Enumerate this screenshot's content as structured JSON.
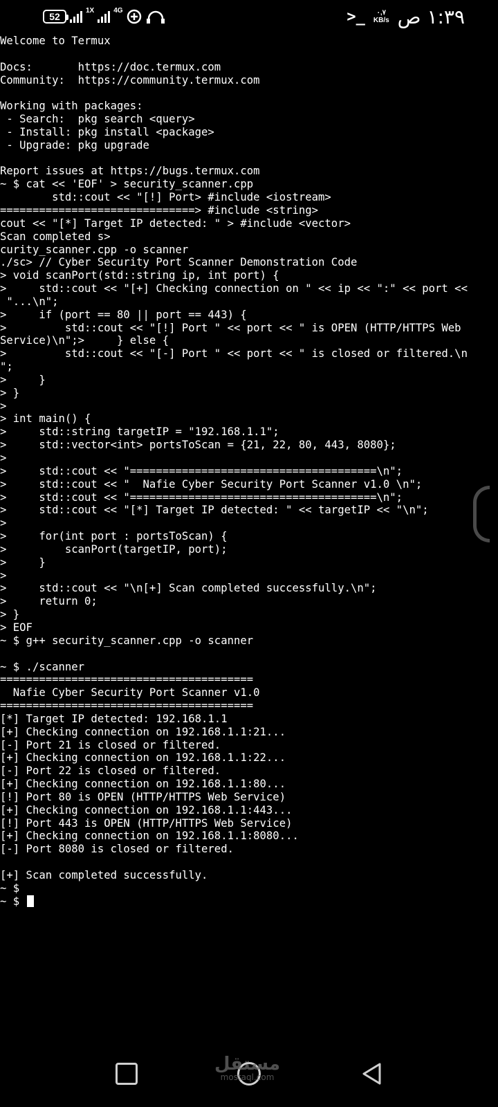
{
  "status_bar": {
    "battery": "52",
    "signal1_label": "1X",
    "signal2_label": "4G",
    "net_speed_value": "٠,٧",
    "net_speed_unit": "KB/s",
    "time": "١:٣٩ ص",
    "icons": [
      "battery-icon",
      "signal-icon",
      "signal-icon",
      "data-saver-icon",
      "headset-icon",
      "terminal-icon"
    ]
  },
  "terminal": {
    "lines": [
      "Welcome to Termux",
      "",
      "Docs:       https://doc.termux.com",
      "Community:  https://community.termux.com",
      "",
      "Working with packages:",
      " - Search:  pkg search <query>",
      " - Install: pkg install <package>",
      " - Upgrade: pkg upgrade",
      "",
      "Report issues at https://bugs.termux.com",
      "~ $ cat << 'EOF' > security_scanner.cpp",
      "        std::cout << \"[!] Port> #include <iostream>",
      "==============================> #include <string>",
      "cout << \"[*] Target IP detected: \" > #include <vector>",
      "Scan completed s>",
      "curity_scanner.cpp -o scanner",
      "./sc> // Cyber Security Port Scanner Demonstration Code",
      "> void scanPort(std::string ip, int port) {",
      ">     std::cout << \"[+] Checking connection on \" << ip << \":\" << port <<",
      " \"...\\n\";",
      ">     if (port == 80 || port == 443) {",
      ">         std::cout << \"[!] Port \" << port << \" is OPEN (HTTP/HTTPS Web",
      "Service)\\n\";>     } else {",
      ">         std::cout << \"[-] Port \" << port << \" is closed or filtered.\\n",
      "\";",
      ">     }",
      "> }",
      ">",
      "> int main() {",
      ">     std::string targetIP = \"192.168.1.1\";",
      ">     std::vector<int> portsToScan = {21, 22, 80, 443, 8080};",
      ">",
      ">     std::cout << \"======================================\\n\";",
      ">     std::cout << \"  Nafie Cyber Security Port Scanner v1.0 \\n\";",
      ">     std::cout << \"======================================\\n\";",
      ">     std::cout << \"[*] Target IP detected: \" << targetIP << \"\\n\";",
      ">",
      ">     for(int port : portsToScan) {",
      ">         scanPort(targetIP, port);",
      ">     }",
      ">",
      ">     std::cout << \"\\n[+] Scan completed successfully.\\n\";",
      ">     return 0;",
      "> }",
      "> EOF",
      "~ $ g++ security_scanner.cpp -o scanner",
      "",
      "~ $ ./scanner",
      "=======================================",
      "  Nafie Cyber Security Port Scanner v1.0",
      "=======================================",
      "[*] Target IP detected: 192.168.1.1",
      "[+] Checking connection on 192.168.1.1:21...",
      "[-] Port 21 is closed or filtered.",
      "[+] Checking connection on 192.168.1.1:22...",
      "[-] Port 22 is closed or filtered.",
      "[+] Checking connection on 192.168.1.1:80...",
      "[!] Port 80 is OPEN (HTTP/HTTPS Web Service)",
      "[+] Checking connection on 192.168.1.1:443...",
      "[!] Port 443 is OPEN (HTTP/HTTPS Web Service)",
      "[+] Checking connection on 192.168.1.1:8080...",
      "[-] Port 8080 is closed or filtered.",
      "",
      "[+] Scan completed successfully.",
      "~ $",
      "~ $ "
    ]
  },
  "nav_bar": {
    "buttons": [
      "recents-button",
      "home-button",
      "back-button"
    ],
    "watermark_text": "مستقل",
    "watermark_sub": "mostaql.com"
  },
  "colors": {
    "background": "#000000",
    "text": "#ffffff",
    "scrollbar": "#4a4a4a",
    "nav_icons": "#cfcfcf"
  }
}
